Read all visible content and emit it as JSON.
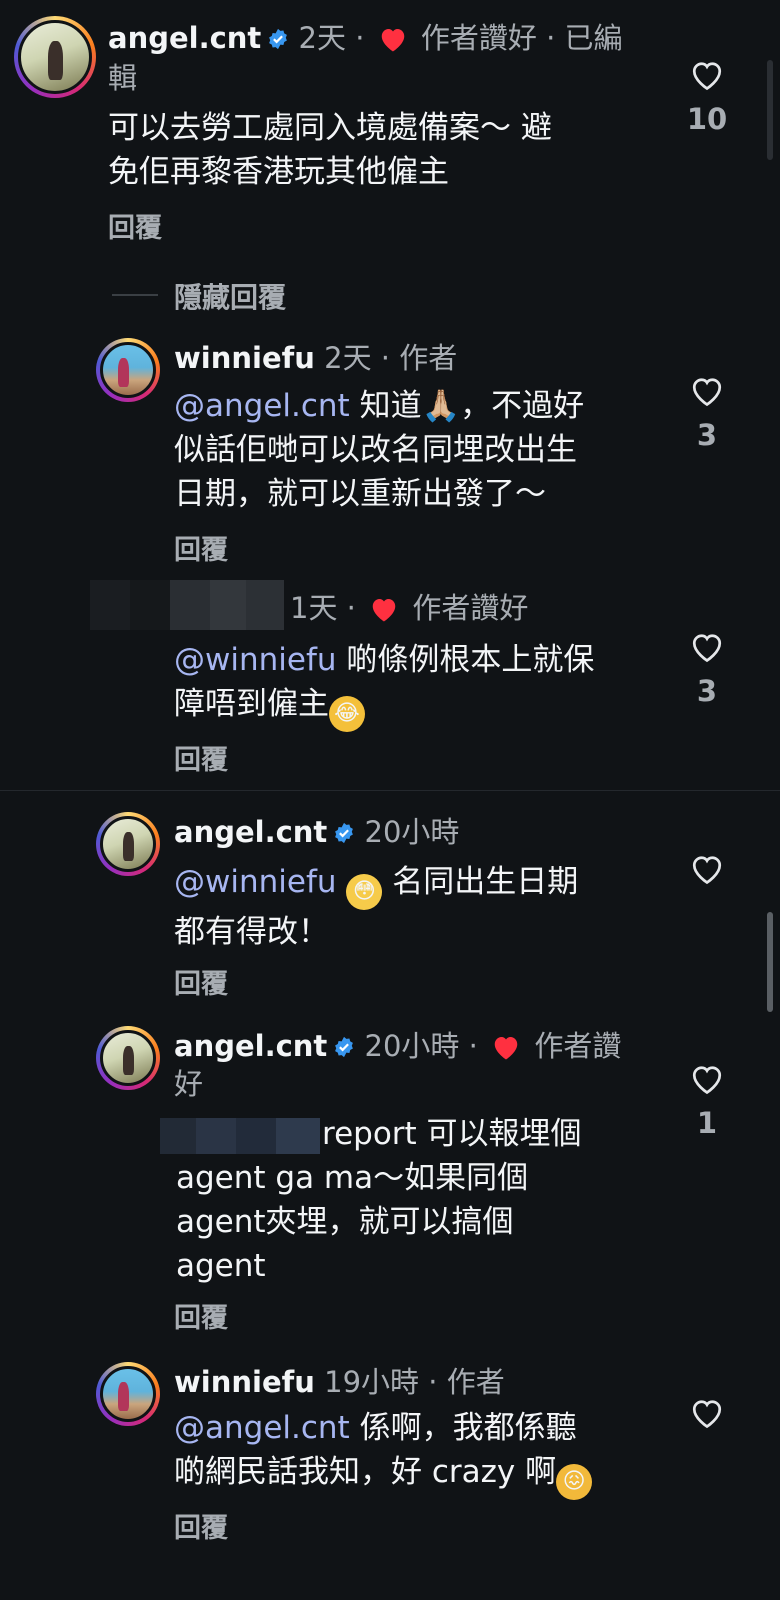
{
  "comments": [
    {
      "username": "angel.cnt",
      "verified": true,
      "time": "2天",
      "author_liked_label": "作者讚好",
      "edited_label": "已編",
      "edited_label_wrap": "輯",
      "text": "可以去勞工處同入境處備案～ 避",
      "text_line2": "免佢再黎香港玩其他僱主",
      "reply_label": "回覆",
      "likes": "10"
    },
    {
      "username": "winniefu",
      "time": "2天",
      "author_label": "作者",
      "mention": "@angel.cnt",
      "text_a": " 知道🙏🏼，不過好",
      "text_line2": "似話佢哋可以改名同埋改出生",
      "text_line3": "日期，就可以重新出發了～",
      "reply_label": "回覆",
      "likes": "3"
    },
    {
      "time": "1天",
      "author_liked_label": "作者讚好",
      "mention": "@winniefu",
      "text_a": " 啲條例根本上就保",
      "text_line2": "障唔到僱主",
      "reply_label": "回覆",
      "likes": "3"
    },
    {
      "username": "angel.cnt",
      "verified": true,
      "time": "20小時",
      "mention": "@winniefu",
      "text_a": " 名同出生日期",
      "text_line2": "都有得改！",
      "reply_label": "回覆"
    },
    {
      "username": "angel.cnt",
      "verified": true,
      "time": "20小時",
      "author_liked_label": "作者讚",
      "author_liked_wrap": "好",
      "text_a": " report 可以報埋個",
      "text_line2": "agent ga ma～如果同個",
      "text_line3": "agent夾埋，就可以搞個",
      "text_line4": "agent",
      "reply_label": "回覆",
      "likes": "1"
    },
    {
      "username": "winniefu",
      "time": "19小時",
      "author_label": "作者",
      "mention": "@angel.cnt",
      "text_a": " 係啊，我都係聽",
      "text_line2": "啲網民話我知，好 crazy 啊",
      "reply_label": "回覆"
    }
  ],
  "hide_replies_label": "隱藏回覆",
  "separator": "·",
  "colors": {
    "background": "#101316",
    "mention": "#a7b6f1",
    "secondary_text": "#a8adb3",
    "verified_blue": "#3897f0",
    "heart_red": "#ff3040"
  },
  "icons": {
    "verified": "verified-badge-icon",
    "liked_by_author": "heart-filled-icon",
    "like": "heart-outline-icon"
  }
}
